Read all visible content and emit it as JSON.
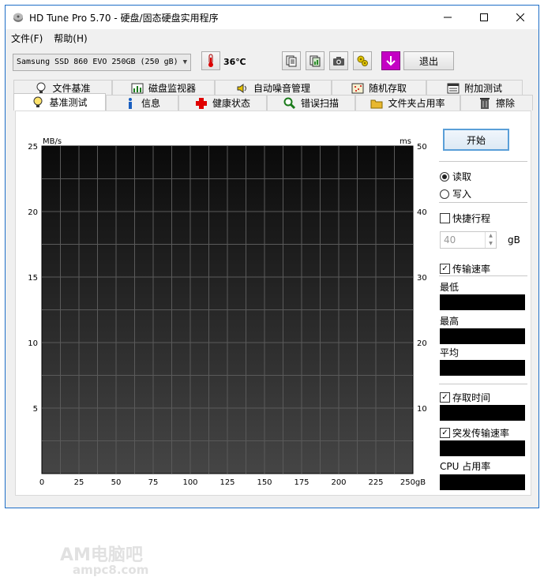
{
  "window": {
    "title": "HD Tune Pro 5.70 - 硬盘/固态硬盘实用程序"
  },
  "menu": {
    "items": [
      "文件(F)",
      "帮助(H)"
    ]
  },
  "toolbar": {
    "drive": "Samsung SSD 860 EVO 250GB (250 gB)",
    "temperature": "36℃",
    "exit_label": "退出",
    "icons": [
      "copy-text-icon",
      "copy-screen-icon",
      "camera-icon",
      "options-icon",
      "download-icon"
    ]
  },
  "tabs": {
    "top": [
      "文件基准",
      "磁盘监视器",
      "自动噪音管理",
      "随机存取",
      "附加测试"
    ],
    "bottom": [
      "基准测试",
      "信息",
      "健康状态",
      "错误扫描",
      "文件夹占用率",
      "擦除"
    ],
    "active": "基准测试"
  },
  "chart_data": {
    "type": "line",
    "title": "",
    "left_unit": "MB/s",
    "right_unit": "ms",
    "xlim": [
      0,
      250
    ],
    "ylim_left": [
      0,
      25
    ],
    "ylim_right": [
      0,
      50
    ],
    "x_ticks": [
      "0",
      "25",
      "50",
      "75",
      "100",
      "125",
      "150",
      "175",
      "200",
      "225",
      "250gB"
    ],
    "y_left_ticks": [
      "5",
      "10",
      "15",
      "20",
      "25"
    ],
    "y_right_ticks": [
      "10",
      "20",
      "30",
      "40",
      "50"
    ],
    "grid": true,
    "series": []
  },
  "controls": {
    "start_label": "开始",
    "mode_read": "读取",
    "mode_write": "写入",
    "mode_selected": "read",
    "quick_stroke": "快捷行程",
    "quick_stroke_checked": false,
    "quick_value": "40",
    "quick_unit": "gB",
    "transfer_rate": "传输速率",
    "transfer_rate_checked": true,
    "min_label": "最低",
    "max_label": "最高",
    "avg_label": "平均",
    "access_time": "存取时间",
    "access_time_checked": true,
    "burst_rate": "突发传输速率",
    "burst_rate_checked": true,
    "cpu_usage": "CPU 占用率"
  },
  "watermark": {
    "line1": "AM电脑吧",
    "line2": "ampc8.com"
  }
}
